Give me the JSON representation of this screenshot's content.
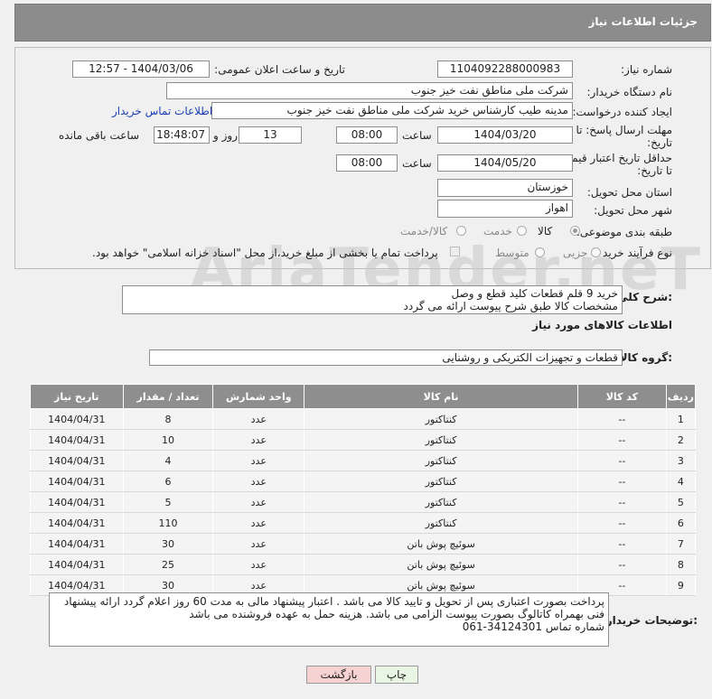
{
  "header": {
    "title": "جزئیات اطلاعات نیاز"
  },
  "form": {
    "need_number_label": "شماره نیاز:",
    "need_number": "1104092288000983",
    "announce_label": "تاریخ و ساعت اعلان عمومی:",
    "announce_value": "1404/03/06 - 12:57",
    "buyer_org_label": "نام دستگاه خریدار:",
    "buyer_org": "شرکت ملی مناطق نفت خیز جنوب",
    "creator_label": "ایجاد کننده درخواست:",
    "creator": "مدینه طیب کارشناس خرید شرکت ملی مناطق نفت خیز جنوب",
    "contact_link": "اطلاعات تماس خریدار",
    "deadline_label_1": "مهلت ارسال پاسخ: تا",
    "deadline_label_2": "تاریخ:",
    "deadline_date": "1404/03/20",
    "time_label": "ساعت",
    "deadline_time": "08:00",
    "days_value": "13",
    "days_label": "روز و",
    "remaining_time": "18:48:07",
    "remaining_label": "ساعت باقی مانده",
    "validity_label_1": "حداقل تاریخ اعتبار قیمت:",
    "validity_label_2": "تا تاریخ:",
    "validity_date": "1404/05/20",
    "validity_time": "08:00",
    "province_label": "استان محل تحویل:",
    "province": "خوزستان",
    "city_label": "شهر محل تحویل:",
    "city": "اهواز",
    "category_label": "طبقه بندی موضوعی:",
    "category_options": [
      "کالا",
      "خدمت",
      "کالا/خدمت"
    ],
    "process_label": "نوع فرآیند خرید :",
    "process_options": [
      "جزیی",
      "متوسط"
    ],
    "payment_note": "پرداخت تمام یا بخشی از مبلغ خرید،از محل \"اسناد خزانه اسلامی\" خواهد بود."
  },
  "description": {
    "label": "شرح کلی نیاز:",
    "line1": "خرید 9 قلم قطعات  کلید قطع و وصل",
    "line2": "مشخصات کالا طبق شرح پیوست ارائه می گردد"
  },
  "goods_info_title": "اطلاعات کالاهای مورد نیاز",
  "goods_group": {
    "label": "گروه کالا:",
    "value": "قطعات و تجهیزات الکتریکی و روشنایی"
  },
  "table": {
    "headers": [
      "ردیف",
      "کد کالا",
      "نام کالا",
      "واحد شمارش",
      "تعداد / مقدار",
      "تاریخ نیاز"
    ],
    "rows": [
      [
        "1",
        "--",
        "کنتاکتور",
        "عدد",
        "8",
        "1404/04/31"
      ],
      [
        "2",
        "--",
        "کنتاکتور",
        "عدد",
        "10",
        "1404/04/31"
      ],
      [
        "3",
        "--",
        "کنتاکتور",
        "عدد",
        "4",
        "1404/04/31"
      ],
      [
        "4",
        "--",
        "کنتاکتور",
        "عدد",
        "6",
        "1404/04/31"
      ],
      [
        "5",
        "--",
        "کنتاکتور",
        "عدد",
        "5",
        "1404/04/31"
      ],
      [
        "6",
        "--",
        "کنتاکتور",
        "عدد",
        "110",
        "1404/04/31"
      ],
      [
        "7",
        "--",
        "سوئیچ پوش باتن",
        "عدد",
        "30",
        "1404/04/31"
      ],
      [
        "8",
        "--",
        "سوئیچ پوش باتن",
        "عدد",
        "25",
        "1404/04/31"
      ],
      [
        "9",
        "--",
        "سوئیچ پوش باتن",
        "عدد",
        "30",
        "1404/04/31"
      ]
    ]
  },
  "buyer_notes": {
    "label": "توضیحات خریدار:",
    "line1": "پرداخت بصورت اعتباری پس از تحویل و تایید کالا می باشد . اعتبار پیشنهاد مالی به مدت 60 روز اعلام گردد  ارائه پیشنهاد",
    "line2": "فنی بهمراه کاتالوگ بصورت پیوست الزامی می باشد. هزینه حمل به عهده فروشنده می باشد",
    "line3": "شماره تماس 34124301-061"
  },
  "buttons": {
    "print": "چاپ",
    "back": "بازگشت"
  },
  "colors": {
    "header": "#8c8c8c",
    "link": "#1a3fb5",
    "back_button": "#f6d2d2",
    "print_button": "#eaf6e4"
  },
  "watermark": "AriaTender.neT"
}
